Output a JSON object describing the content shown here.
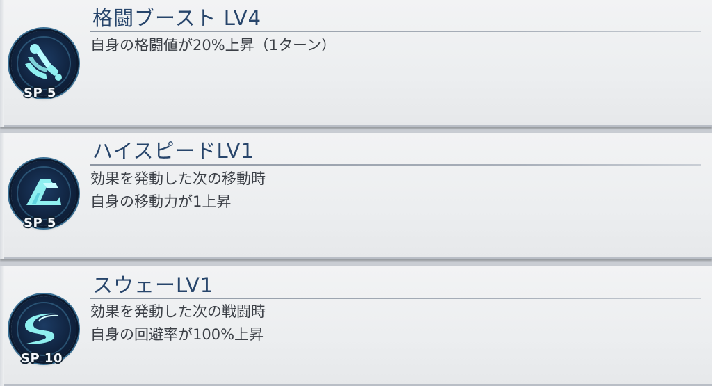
{
  "skills": [
    {
      "title": "格闘ブースト LV4",
      "sp": "SP 5",
      "icon": "fighting-boost-icon",
      "lines": [
        "自身の格闘値が20%上昇（1ターン）"
      ]
    },
    {
      "title": "ハイスピードLV1",
      "sp": "SP 5",
      "icon": "high-speed-icon",
      "lines": [
        "効果を発動した次の移動時",
        "自身の移動力が1上昇"
      ]
    },
    {
      "title": "スウェーLV1",
      "sp": "SP 10",
      "icon": "sway-icon",
      "lines": [
        "効果を発動した次の戦闘時",
        "自身の回避率が100%上昇"
      ]
    }
  ],
  "colors": {
    "title": "#27456b",
    "text": "#3b3f46",
    "icon_glow": "#8ff0f0",
    "badge": "#10233f"
  }
}
